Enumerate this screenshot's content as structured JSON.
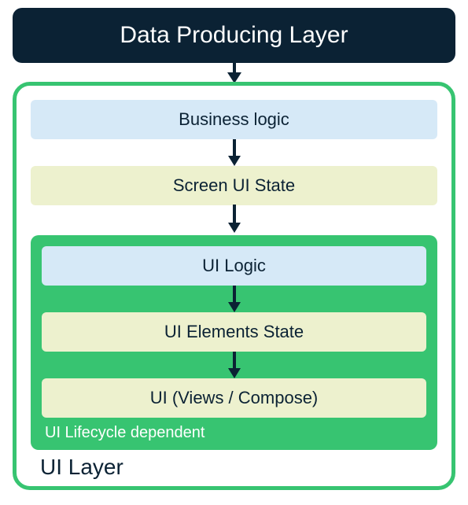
{
  "top_layer": {
    "label": "Data Producing Layer"
  },
  "ui_layer": {
    "label": "UI Layer",
    "business_logic": "Business logic",
    "screen_ui_state": "Screen UI State",
    "lifecycle": {
      "label": "UI Lifecycle dependent",
      "ui_logic": "UI Logic",
      "ui_elements_state": "UI Elements State",
      "ui_views": "UI (Views / Compose)"
    }
  },
  "colors": {
    "dark": "#0b2234",
    "green": "#37c471",
    "blue_box": "#d6e9f7",
    "yellow_box": "#edf1ce"
  }
}
